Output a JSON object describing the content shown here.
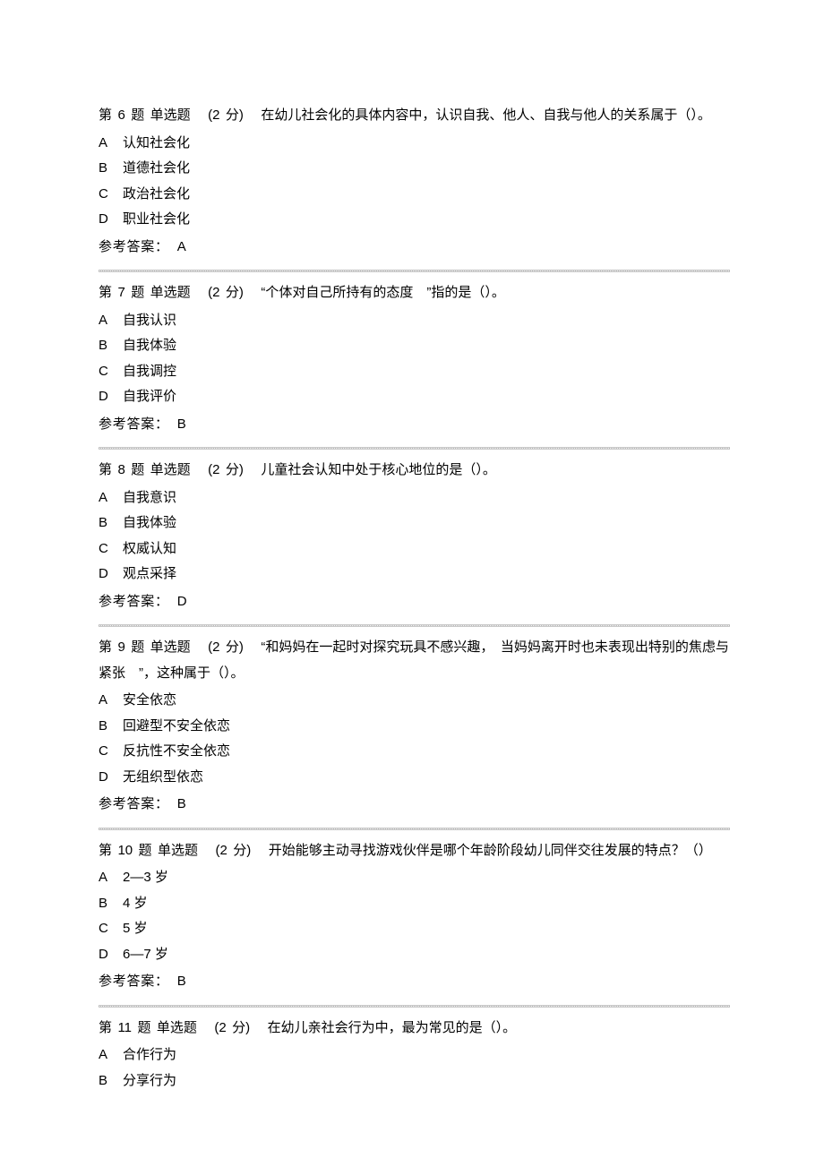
{
  "labels": {
    "answer_prefix": "参考答案：",
    "question_prefix": "第",
    "question_suffix": "题",
    "points_open": "(",
    "points_close": ")",
    "points_unit": "分"
  },
  "questions": [
    {
      "number": "6",
      "type": "单选题",
      "points": "2",
      "text_parts": [
        "在幼儿社会化的具体内容中，认识自我、他人、自我与他人的关系属于（）。"
      ],
      "options": [
        {
          "letter": "A",
          "text": "认知社会化"
        },
        {
          "letter": "B",
          "text": "道德社会化"
        },
        {
          "letter": "C",
          "text": "政治社会化"
        },
        {
          "letter": "D",
          "text": "职业社会化"
        }
      ],
      "answer": "A"
    },
    {
      "number": "7",
      "type": "单选题",
      "points": "2",
      "text_parts": [
        "“个体对自己所持有的态度　”指的是（）。"
      ],
      "options": [
        {
          "letter": "A",
          "text": "自我认识"
        },
        {
          "letter": "B",
          "text": "自我体验"
        },
        {
          "letter": "C",
          "text": "自我调控"
        },
        {
          "letter": "D",
          "text": "自我评价"
        }
      ],
      "answer": "B"
    },
    {
      "number": "8",
      "type": "单选题",
      "points": "2",
      "text_parts": [
        "儿童社会认知中处于核心地位的是（）。"
      ],
      "options": [
        {
          "letter": "A",
          "text": "自我意识"
        },
        {
          "letter": "B",
          "text": "自我体验"
        },
        {
          "letter": "C",
          "text": "权威认知"
        },
        {
          "letter": "D",
          "text": "观点采择"
        }
      ],
      "answer": "D"
    },
    {
      "number": "9",
      "type": "单选题",
      "points": "2",
      "text_parts": [
        "“和妈妈在一起时对探究玩具不感兴趣，　当妈妈离开时也未表现出特别的焦虑与紧张　”，这种属于（）。"
      ],
      "options": [
        {
          "letter": "A",
          "text": "安全依恋"
        },
        {
          "letter": "B",
          "text": "回避型不安全依恋"
        },
        {
          "letter": "C",
          "text": "反抗性不安全依恋"
        },
        {
          "letter": "D",
          "text": "无组织型依恋"
        }
      ],
      "answer": "B"
    },
    {
      "number": "10",
      "type": "单选题",
      "points": "2",
      "text_parts": [
        "开始能够主动寻找游戏伙伴是哪个年龄阶段幼儿同伴交往发展的特点？（）"
      ],
      "options": [
        {
          "letter": "A",
          "text": "2—3 岁"
        },
        {
          "letter": "B",
          "text": "4 岁"
        },
        {
          "letter": "C",
          "text": "5 岁"
        },
        {
          "letter": "D",
          "text": "6—7 岁"
        }
      ],
      "answer": "B"
    },
    {
      "number": "11",
      "type": "单选题",
      "points": "2",
      "text_parts": [
        "在幼儿亲社会行为中，最为常见的是（）。"
      ],
      "options": [
        {
          "letter": "A",
          "text": "合作行为"
        },
        {
          "letter": "B",
          "text": "分享行为"
        }
      ],
      "answer": null,
      "partial": true
    }
  ]
}
